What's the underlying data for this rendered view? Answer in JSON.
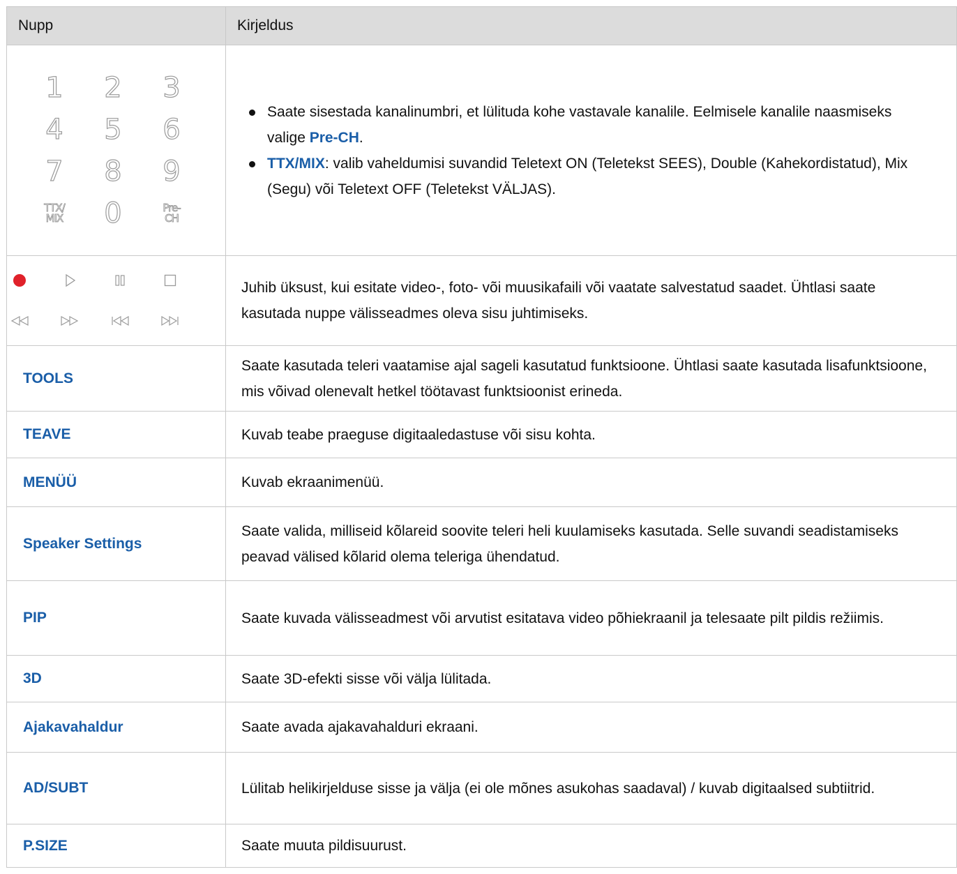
{
  "header": {
    "col1": "Nupp",
    "col2": "Kirjeldus"
  },
  "numpad": {
    "keys": [
      "1",
      "2",
      "3",
      "4",
      "5",
      "6",
      "7",
      "8",
      "9"
    ],
    "ttx_top": "TTX/",
    "ttx_bottom": "MIX",
    "zero": "0",
    "prech_top": "Pre-",
    "prech_bottom": "CH"
  },
  "media_icons": [
    "record-icon",
    "play-icon",
    "pause-icon",
    "stop-icon",
    "rewind-icon",
    "fast-forward-icon",
    "previous-icon",
    "next-icon"
  ],
  "colors": {
    "accent": "#1a5ea8",
    "record": "#e0212a",
    "header_bg": "#dcdcdc",
    "border": "#c9c9c9"
  },
  "rows": {
    "numbers": {
      "b1_pre": "Saate sisestada kanalinumbri, et lülituda kohe vastavale kanalile. Eelmisele kanalile naasmiseks valige ",
      "b1_hl": "Pre-CH",
      "b1_post": ".",
      "b2_hl": "TTX/MIX",
      "b2_post": ": valib vaheldumisi suvandid Teletext ON (Teletekst SEES), Double (Kahekordistatud), Mix (Segu) või Teletext OFF (Teletekst VÄLJAS)."
    },
    "media": {
      "desc": "Juhib üksust, kui esitate video-, foto- või muusikafaili või vaatate salvestatud saadet. Ühtlasi saate kasutada nuppe välisseadmes oleva sisu juhtimiseks."
    },
    "tools": {
      "key": "TOOLS",
      "desc": "Saate kasutada teleri vaatamise ajal sageli kasutatud funktsioone. Ühtlasi saate kasutada lisafunktsioone, mis võivad olenevalt hetkel töötavast funktsioonist erineda."
    },
    "teave": {
      "key": "TEAVE",
      "desc": "Kuvab teabe praeguse digitaaledastuse või sisu kohta."
    },
    "menu": {
      "key": "MENÜÜ",
      "desc": "Kuvab ekraanimenüü."
    },
    "speaker": {
      "key": "Speaker Settings",
      "desc": "Saate valida, milliseid kõlareid soovite teleri heli kuulamiseks kasutada. Selle suvandi seadistamiseks peavad välised kõlarid olema teleriga ühendatud."
    },
    "pip": {
      "key": "PIP",
      "desc": "Saate kuvada välisseadmest või arvutist esitatava video põhiekraanil ja telesaate pilt pildis režiimis."
    },
    "threed": {
      "key": "3D",
      "desc": "Saate 3D-efekti sisse või välja lülitada."
    },
    "schedule": {
      "key": "Ajakavahaldur",
      "desc": "Saate avada ajakavahalduri ekraani."
    },
    "adsubt": {
      "key": "AD/SUBT",
      "desc": "Lülitab helikirjelduse sisse ja välja (ei ole mõnes asukohas saadaval)  / kuvab digitaalsed subtiitrid."
    },
    "psize": {
      "key": "P.SIZE",
      "desc": "Saate muuta pildisuurust."
    }
  }
}
